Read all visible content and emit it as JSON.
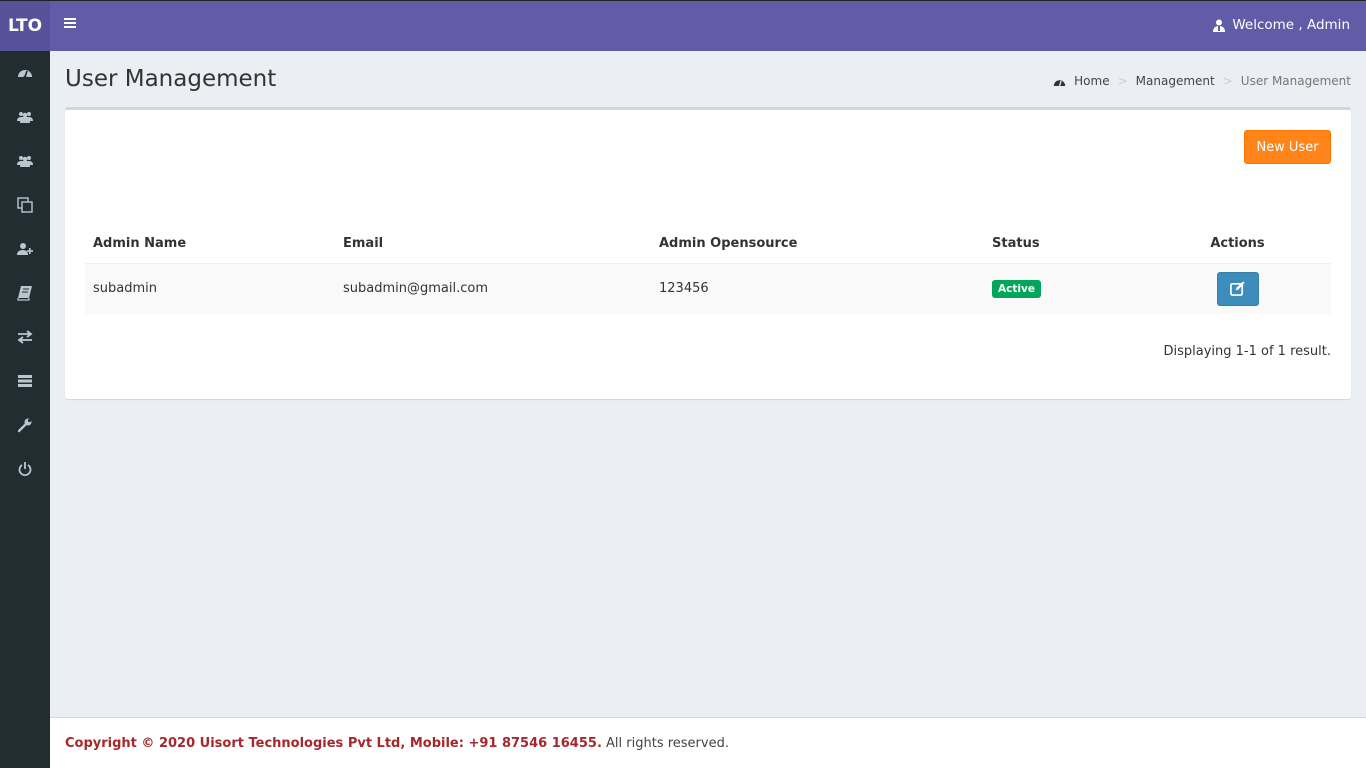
{
  "app": {
    "logo": "LTO",
    "welcome_text": "Welcome , Admin"
  },
  "sidebar": {
    "items": [
      {
        "icon": "dashboard-icon"
      },
      {
        "icon": "users-icon"
      },
      {
        "icon": "users-group-icon"
      },
      {
        "icon": "clone-icon"
      },
      {
        "icon": "user-plus-icon"
      },
      {
        "icon": "book-icon"
      },
      {
        "icon": "exchange-icon"
      },
      {
        "icon": "server-icon"
      },
      {
        "icon": "wrench-icon"
      },
      {
        "icon": "power-icon"
      }
    ]
  },
  "page": {
    "title": "User Management",
    "breadcrumb": [
      "Home",
      "Management",
      "User Management"
    ]
  },
  "toolbar": {
    "new_user_label": "New User"
  },
  "table": {
    "columns": [
      "Admin Name",
      "Email",
      "Admin Opensource",
      "Status",
      "Actions"
    ],
    "rows": [
      {
        "name": "subadmin",
        "email": "subadmin@gmail.com",
        "opensource": "123456",
        "status": "Active"
      }
    ],
    "summary": "Displaying 1-1 of 1 result."
  },
  "footer": {
    "copyright": "Copyright © 2020 Uisort Technologies Pvt Ltd, Mobile: +91 87546 16455.",
    "rights": " All rights reserved."
  },
  "colors": {
    "header": "#605ca8",
    "sidebar": "#222d32",
    "accent_orange": "#ff851b",
    "status_active": "#00a65a",
    "edit_button": "#3c8dbc",
    "footer_brand": "#a5282c"
  }
}
